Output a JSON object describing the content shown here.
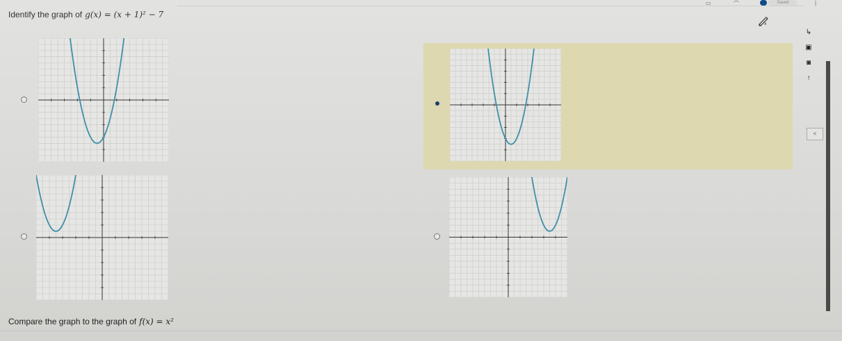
{
  "question": {
    "prefix": "Identify the graph of",
    "function": "g(x) = (x + 1)² − 7"
  },
  "compare": {
    "prefix": "Compare the graph to the graph of",
    "function": "f(x) = x²"
  },
  "options": [
    {
      "id": "A",
      "selected": false,
      "vertex": [
        -1,
        -7
      ]
    },
    {
      "id": "B",
      "selected": true,
      "vertex": [
        1,
        -7
      ]
    },
    {
      "id": "C",
      "selected": false,
      "vertex": [
        -7,
        1
      ]
    },
    {
      "id": "D",
      "selected": false,
      "vertex": [
        7,
        1
      ]
    }
  ],
  "axis": {
    "xmin": -10,
    "xmax": 10,
    "ymin": -10,
    "ymax": 10
  },
  "colors": {
    "curve": "#3f8fa8",
    "selected_highlight": "#ddd8b0",
    "selected_radio": "#1d3c6e"
  },
  "toolbar": {
    "calculator_icon": "pencil-calc-icon",
    "status_text": "Saved",
    "tools": [
      "cursor-icon",
      "save-icon",
      "camera-icon",
      "up-arrow-icon"
    ],
    "mini_box_label": "<"
  }
}
